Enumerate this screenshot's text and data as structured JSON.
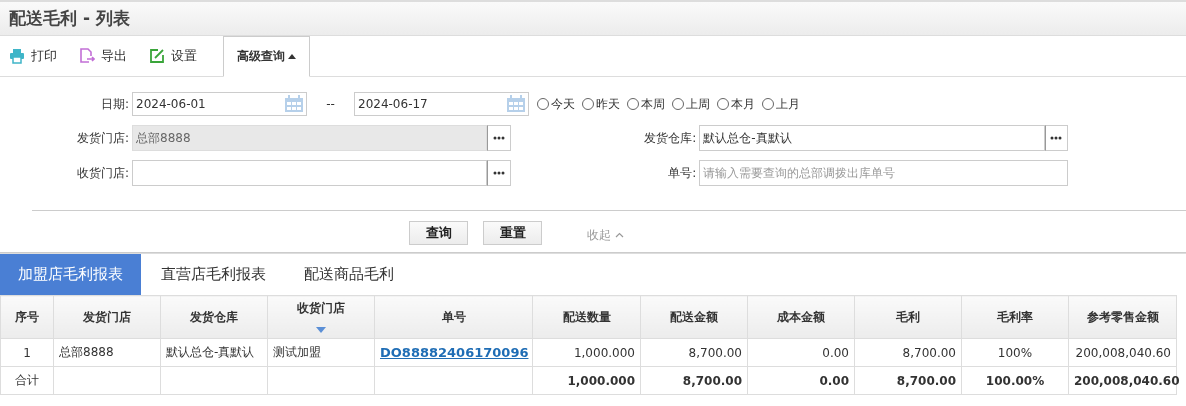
{
  "window": {
    "title": "配送毛利 - 列表"
  },
  "toolbar": [
    {
      "kind": "print",
      "label": "打印"
    },
    {
      "kind": "export",
      "label": "导出"
    },
    {
      "kind": "settings",
      "label": "设置"
    }
  ],
  "advanced_search": {
    "label": "高级查询",
    "expanded": true
  },
  "form": {
    "date_label": "日期:",
    "date_from": "2024-06-01",
    "date_sep": "--",
    "date_to": "2024-06-17",
    "quick_ranges": [
      {
        "label": "今天",
        "selected": false
      },
      {
        "label": "昨天",
        "selected": false
      },
      {
        "label": "本周",
        "selected": false
      },
      {
        "label": "上周",
        "selected": false
      },
      {
        "label": "本月",
        "selected": false
      },
      {
        "label": "上月",
        "selected": false
      }
    ],
    "fields": [
      {
        "label": "发货门店:",
        "value": "总部8888",
        "disabled": true,
        "picker": true
      },
      {
        "label": "发货仓库:",
        "value": "默认总仓-真默认",
        "disabled": false,
        "picker": true
      },
      {
        "label": "收货门店:",
        "disabled": false,
        "picker": true
      },
      {
        "label": "单号:",
        "placeholder": "请输入需要查询的总部调拨出库单号",
        "disabled": false,
        "picker": false
      }
    ],
    "buttons": [
      "查询",
      "重置"
    ],
    "collapse": "收起"
  },
  "tabs": [
    {
      "label": "加盟店毛利报表",
      "selected": true
    },
    {
      "label": "直营店毛利报表",
      "selected": false
    },
    {
      "label": "配送商品毛利",
      "selected": false
    }
  ],
  "table": {
    "columns": [
      {
        "label": "序号",
        "kind": "index",
        "sorted": false
      },
      {
        "label": "发货门店",
        "kind": "text",
        "sorted": false
      },
      {
        "label": "发货仓库",
        "kind": "text",
        "sorted": false
      },
      {
        "label": "收货门店",
        "kind": "text",
        "sorted": true
      },
      {
        "label": "单号",
        "kind": "link",
        "sorted": false
      },
      {
        "label": "配送数量",
        "kind": "number",
        "sorted": false
      },
      {
        "label": "配送金额",
        "kind": "number",
        "sorted": false
      },
      {
        "label": "成本金额",
        "kind": "number",
        "sorted": false
      },
      {
        "label": "毛利",
        "kind": "number",
        "sorted": false
      },
      {
        "label": "毛利率",
        "kind": "percent",
        "sorted": false
      },
      {
        "label": "参考零售金额",
        "kind": "number",
        "sorted": false
      }
    ],
    "rows": [
      [
        "1",
        "总部8888",
        "默认总仓-真默认",
        "测试加盟",
        "DO88882406170096",
        "1,000.000",
        "8,700.00",
        "0.00",
        "8,700.00",
        "100%",
        "200,008,040.60"
      ]
    ],
    "total": {
      "label": "合计",
      "values": [
        "1,000.000",
        "8,700.00",
        "0.00",
        "8,700.00",
        "100.00%",
        "200,008,040.60"
      ]
    }
  }
}
